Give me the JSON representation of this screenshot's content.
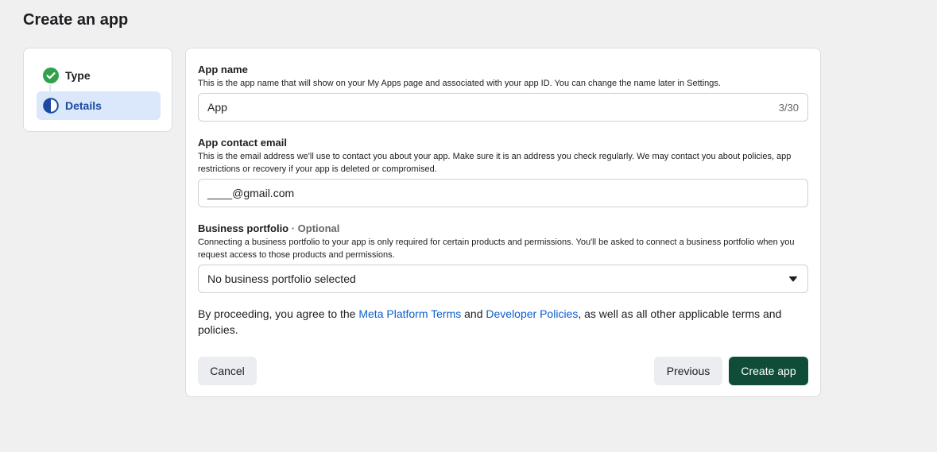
{
  "page": {
    "title": "Create an app"
  },
  "stepper": {
    "steps": [
      {
        "label": "Type",
        "state": "complete",
        "icon": "check-circle-icon"
      },
      {
        "label": "Details",
        "state": "in-progress",
        "icon": "half-circle-icon"
      }
    ]
  },
  "form": {
    "app_name": {
      "label": "App name",
      "description": "This is the app name that will show on your My Apps page and associated with your app ID. You can change the name later in Settings.",
      "value": "App",
      "counter": "3/30"
    },
    "contact_email": {
      "label": "App contact email",
      "description": "This is the email address we'll use to contact you about your app. Make sure it is an address you check regularly. We may contact you about policies, app restrictions or recovery if your app is deleted or compromised.",
      "value": "____@gmail.com"
    },
    "business_portfolio": {
      "label": "Business portfolio",
      "optional": " · Optional",
      "description": "Connecting a business portfolio to your app is only required for certain products and permissions. You'll be asked to connect a business portfolio when you request access to those products and permissions.",
      "selected": "No business portfolio selected"
    },
    "terms": {
      "prefix": "By proceeding, you agree to the ",
      "link1": "Meta Platform Terms",
      "middle": " and ",
      "link2": "Developer Policies",
      "suffix": ", as well as all other applicable terms and policies."
    }
  },
  "buttons": {
    "cancel": "Cancel",
    "previous": "Previous",
    "create": "Create app"
  },
  "colors": {
    "accent_green": "#0f4d38",
    "link_blue": "#0b5fcc",
    "step_active_bg": "#dbe7fa",
    "check_green": "#31a24c"
  }
}
